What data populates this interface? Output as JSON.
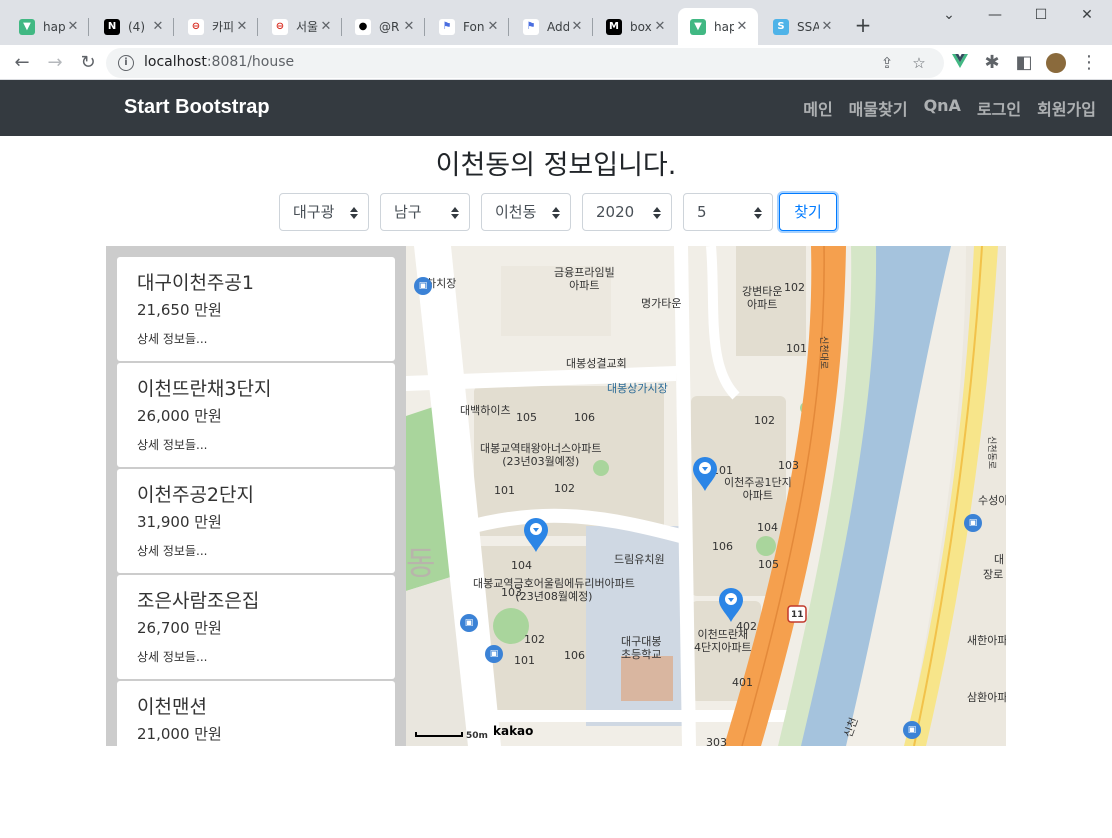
{
  "browser": {
    "tabs": [
      {
        "title": "hap",
        "icon": "vue-icon"
      },
      {
        "title": "(4)",
        "icon": "notion-icon"
      },
      {
        "title": "카피",
        "icon": "red-circle-icon"
      },
      {
        "title": "서울",
        "icon": "red-circle-icon"
      },
      {
        "title": "@R",
        "icon": "github-icon"
      },
      {
        "title": "Fon",
        "icon": "flag-icon"
      },
      {
        "title": "Add",
        "icon": "flag-icon"
      },
      {
        "title": "box",
        "icon": "m-icon"
      },
      {
        "title": "hap",
        "icon": "vue-icon"
      },
      {
        "title": "SSA",
        "icon": "s-icon"
      }
    ],
    "url_host": "localhost",
    "url_rest": ":8081/house"
  },
  "navbar": {
    "brand": "Start Bootstrap",
    "links": [
      "메인",
      "매물찾기",
      "QnA",
      "로그인",
      "회원가입"
    ]
  },
  "heading": "이천동의 정보입니다.",
  "filters": {
    "city": "대구광",
    "district": "남구",
    "dong": "이천동",
    "year": "2020",
    "month": "5",
    "search_label": "찾기"
  },
  "listings": [
    {
      "name": "대구이천주공1",
      "price": "21,650 만원",
      "detail": "상세 정보들..."
    },
    {
      "name": "이천뜨란채3단지",
      "price": "26,000 만원",
      "detail": "상세 정보들..."
    },
    {
      "name": "이천주공2단지",
      "price": "31,900 만원",
      "detail": "상세 정보들..."
    },
    {
      "name": "조은사람조은집",
      "price": "26,700 만원",
      "detail": "상세 정보들..."
    },
    {
      "name": "이천맨션",
      "price": "21,000 만원",
      "detail": ""
    }
  ],
  "map": {
    "labels": {
      "l1": "하치장",
      "l2": "금융프라임빌\n아파트",
      "l3": "명가타운",
      "l4": "강변타운\n아파트",
      "l5": "대봉성결교회",
      "l6": "대봉상가시장",
      "l7": "대백하이츠",
      "l8": "대봉교역태왕아너스아파트\n(23년03월예정)",
      "l9": "이천주공1단지\n아파트",
      "l10": "드림유치원",
      "l11": "대봉교역금호어울림에듀리버아파트\n(23년08월예정)",
      "l12": "이천뜨란채\n4단지아파트",
      "l13": "대구대봉\n초등학교",
      "l14": "수성아",
      "l15": "대",
      "l16": "장로",
      "l17": "새한아파",
      "l18": "삼환아파",
      "l19": "신천",
      "l20": "신천대로",
      "l21": "신천동로",
      "n105": "105",
      "n106": "106",
      "n101": "101",
      "n102": "102",
      "n104": "104",
      "n103": "103",
      "n401": "401",
      "n402": "402",
      "n303": "303",
      "n105b": "105",
      "n101b": "101",
      "n102b": "102",
      "n103b": "103",
      "n104b": "104",
      "n106b": "106",
      "n102c": "102",
      "n101c": "101",
      "n106c": "106",
      "n102d": "102",
      "n101d": "101",
      "route": "11",
      "dong": "동"
    },
    "scale_label": "50m",
    "provider": "kakao"
  },
  "colors": {
    "navbar_bg": "#343a40",
    "accent": "#007bff",
    "panel_bg": "#cccccc",
    "river": "#a5c3dd",
    "highway": "#f5a04e",
    "pin": "#2b85e6"
  }
}
